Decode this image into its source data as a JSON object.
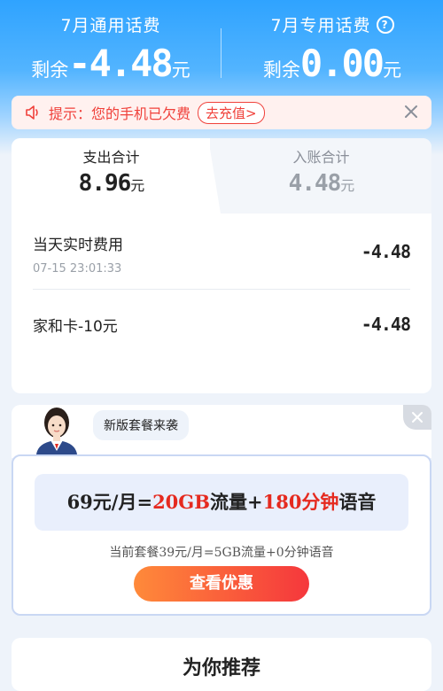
{
  "balances": {
    "general": {
      "title": "7月通用话费",
      "prefix": "剩余",
      "amount": "-4.48",
      "unit": "元"
    },
    "special": {
      "title": "7月专用话费",
      "prefix": "剩余",
      "amount": "0.00",
      "unit": "元"
    }
  },
  "notice": {
    "text": "提示：您的手机已欠费",
    "button": "去充值>"
  },
  "summary": {
    "tabs": [
      {
        "label": "支出合计",
        "value": "8.96",
        "unit": "元"
      },
      {
        "label": "入账合计",
        "value": "4.48",
        "unit": "元"
      }
    ],
    "items": [
      {
        "name": "当天实时费用",
        "time": "07-15 23:01:33",
        "amount": "-4.48"
      },
      {
        "name": "家和卡-10元",
        "amount": "-4.48"
      }
    ]
  },
  "promo": {
    "bubble": "新版套餐来袭",
    "plan_parts": [
      "69元/月=",
      "20GB",
      "流量+",
      "180分钟",
      "语音"
    ],
    "current": "当前套餐39元/月=5GB流量+0分钟语音",
    "cta": "查看优惠"
  },
  "bottom": {
    "title": "为你推荐"
  },
  "colors": {
    "brand_blue": "#2fa3ff",
    "alert_red": "#f0413b",
    "cta_start": "#ff8a3a",
    "cta_end": "#f5373c"
  }
}
